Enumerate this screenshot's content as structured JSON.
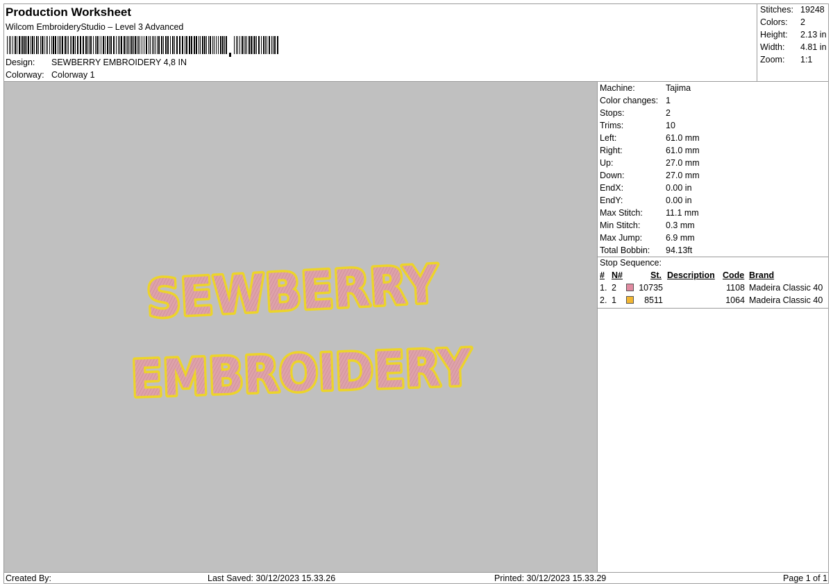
{
  "header": {
    "title": "Production Worksheet",
    "software": "Wilcom EmbroideryStudio – Level 3 Advanced",
    "design_label": "Design:",
    "design_value": "SEWBERRY EMBROIDERY 4,8 IN",
    "colorway_label": "Colorway:",
    "colorway_value": "Colorway 1"
  },
  "summary": {
    "stitches_label": "Stitches:",
    "stitches": "19248",
    "colors_label": "Colors:",
    "colors": "2",
    "height_label": "Height:",
    "height": "2.13 in",
    "width_label": "Width:",
    "width": "4.81 in",
    "zoom_label": "Zoom:",
    "zoom": "1:1"
  },
  "machine": {
    "machine_label": "Machine:",
    "machine": "Tajima",
    "color_changes_label": "Color changes:",
    "color_changes": "1",
    "stops_label": "Stops:",
    "stops": "2",
    "trims_label": "Trims:",
    "trims": "10",
    "left_label": "Left:",
    "left": "61.0 mm",
    "right_label": "Right:",
    "right": "61.0 mm",
    "up_label": "Up:",
    "up": "27.0 mm",
    "down_label": "Down:",
    "down": "27.0 mm",
    "endx_label": "EndX:",
    "endx": "0.00 in",
    "endy_label": "EndY:",
    "endy": "0.00 in",
    "max_stitch_label": "Max Stitch:",
    "max_stitch": "11.1 mm",
    "min_stitch_label": "Min Stitch:",
    "min_stitch": "0.3 mm",
    "max_jump_label": "Max Jump:",
    "max_jump": "6.9 mm",
    "total_bobbin_label": "Total Bobbin:",
    "total_bobbin": "94.13ft"
  },
  "stop_sequence": {
    "title": "Stop Sequence:",
    "headers": {
      "num": "#",
      "n": "N#",
      "st": "St.",
      "description": "Description",
      "code": "Code",
      "brand": "Brand"
    },
    "rows": [
      {
        "num": "1.",
        "n": "2",
        "color": "#e08aa0",
        "st": "10735",
        "description": "",
        "code": "1108",
        "brand": "Madeira Classic 40"
      },
      {
        "num": "2.",
        "n": "1",
        "color": "#f2b632",
        "st": "8511",
        "description": "",
        "code": "1064",
        "brand": "Madeira Classic 40"
      }
    ]
  },
  "artwork": {
    "line1": "SEWBERRY",
    "line2": "EMBROIDERY",
    "fill_color": "#e3a7ad",
    "outline_color": "#ecd42a",
    "background": "#c0c0c0"
  },
  "footer": {
    "created_by": "Created By:",
    "last_saved": "Last Saved: 30/12/2023 15.33.26",
    "printed": "Printed: 30/12/2023 15.33.29",
    "page": "Page 1 of 1"
  }
}
